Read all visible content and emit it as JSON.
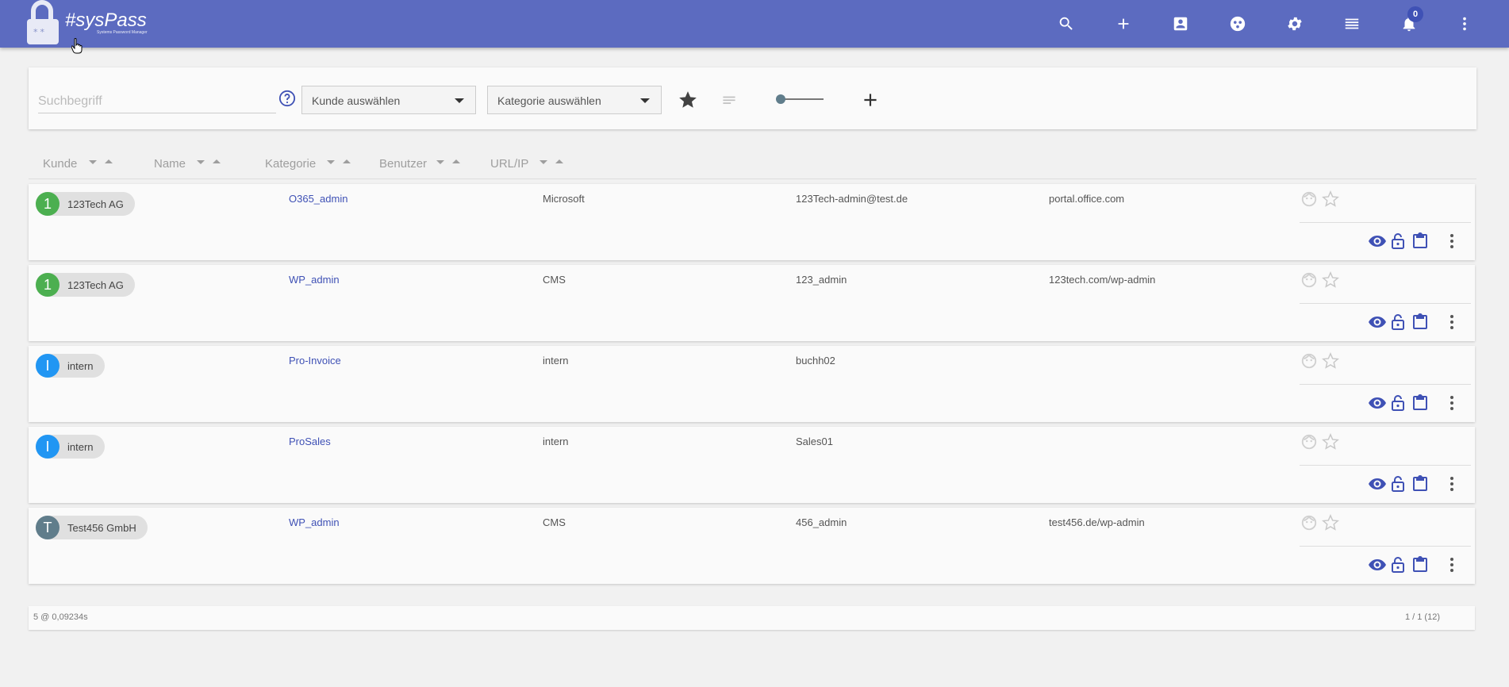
{
  "app": {
    "title": "#sysPass",
    "subtitle": "Systems Password Manager"
  },
  "header": {
    "notification_count": "0",
    "icons": [
      "search-icon",
      "add-icon",
      "contacts-icon",
      "group-icon",
      "settings-icon",
      "list-icon",
      "bell-icon",
      "more-vert-icon"
    ]
  },
  "search": {
    "placeholder": "Suchbegriff",
    "customer_select": "Kunde auswählen",
    "category_select": "Kategorie auswählen"
  },
  "sort": {
    "customer": "Kunde",
    "name": "Name",
    "category": "Kategorie",
    "user": "Benutzer",
    "url": "URL/IP"
  },
  "accounts": [
    {
      "initial": "1",
      "avatar_color": "#4caf50",
      "customer": "123Tech AG",
      "name": "O365_admin",
      "category": "Microsoft",
      "login": "123Tech-admin@test.de",
      "url": "portal.office.com"
    },
    {
      "initial": "1",
      "avatar_color": "#4caf50",
      "customer": "123Tech AG",
      "name": "WP_admin",
      "category": "CMS",
      "login": "123_admin",
      "url": "123tech.com/wp-admin"
    },
    {
      "initial": "I",
      "avatar_color": "#2196f3",
      "customer": "intern",
      "name": "Pro-Invoice",
      "category": "intern",
      "login": "buchh02",
      "url": ""
    },
    {
      "initial": "I",
      "avatar_color": "#2196f3",
      "customer": "intern",
      "name": "ProSales",
      "category": "intern",
      "login": "Sales01",
      "url": ""
    },
    {
      "initial": "T",
      "avatar_color": "#607d8b",
      "customer": "Test456 GmbH",
      "name": "WP_admin",
      "category": "CMS",
      "login": "456_admin",
      "url": "test456.de/wp-admin"
    }
  ],
  "footer": {
    "stats": "5 @ 0,09234s",
    "pagination": "1 / 1 (12)"
  },
  "colors": {
    "primary": "#5c6bc0",
    "accent": "#3f51b5"
  }
}
